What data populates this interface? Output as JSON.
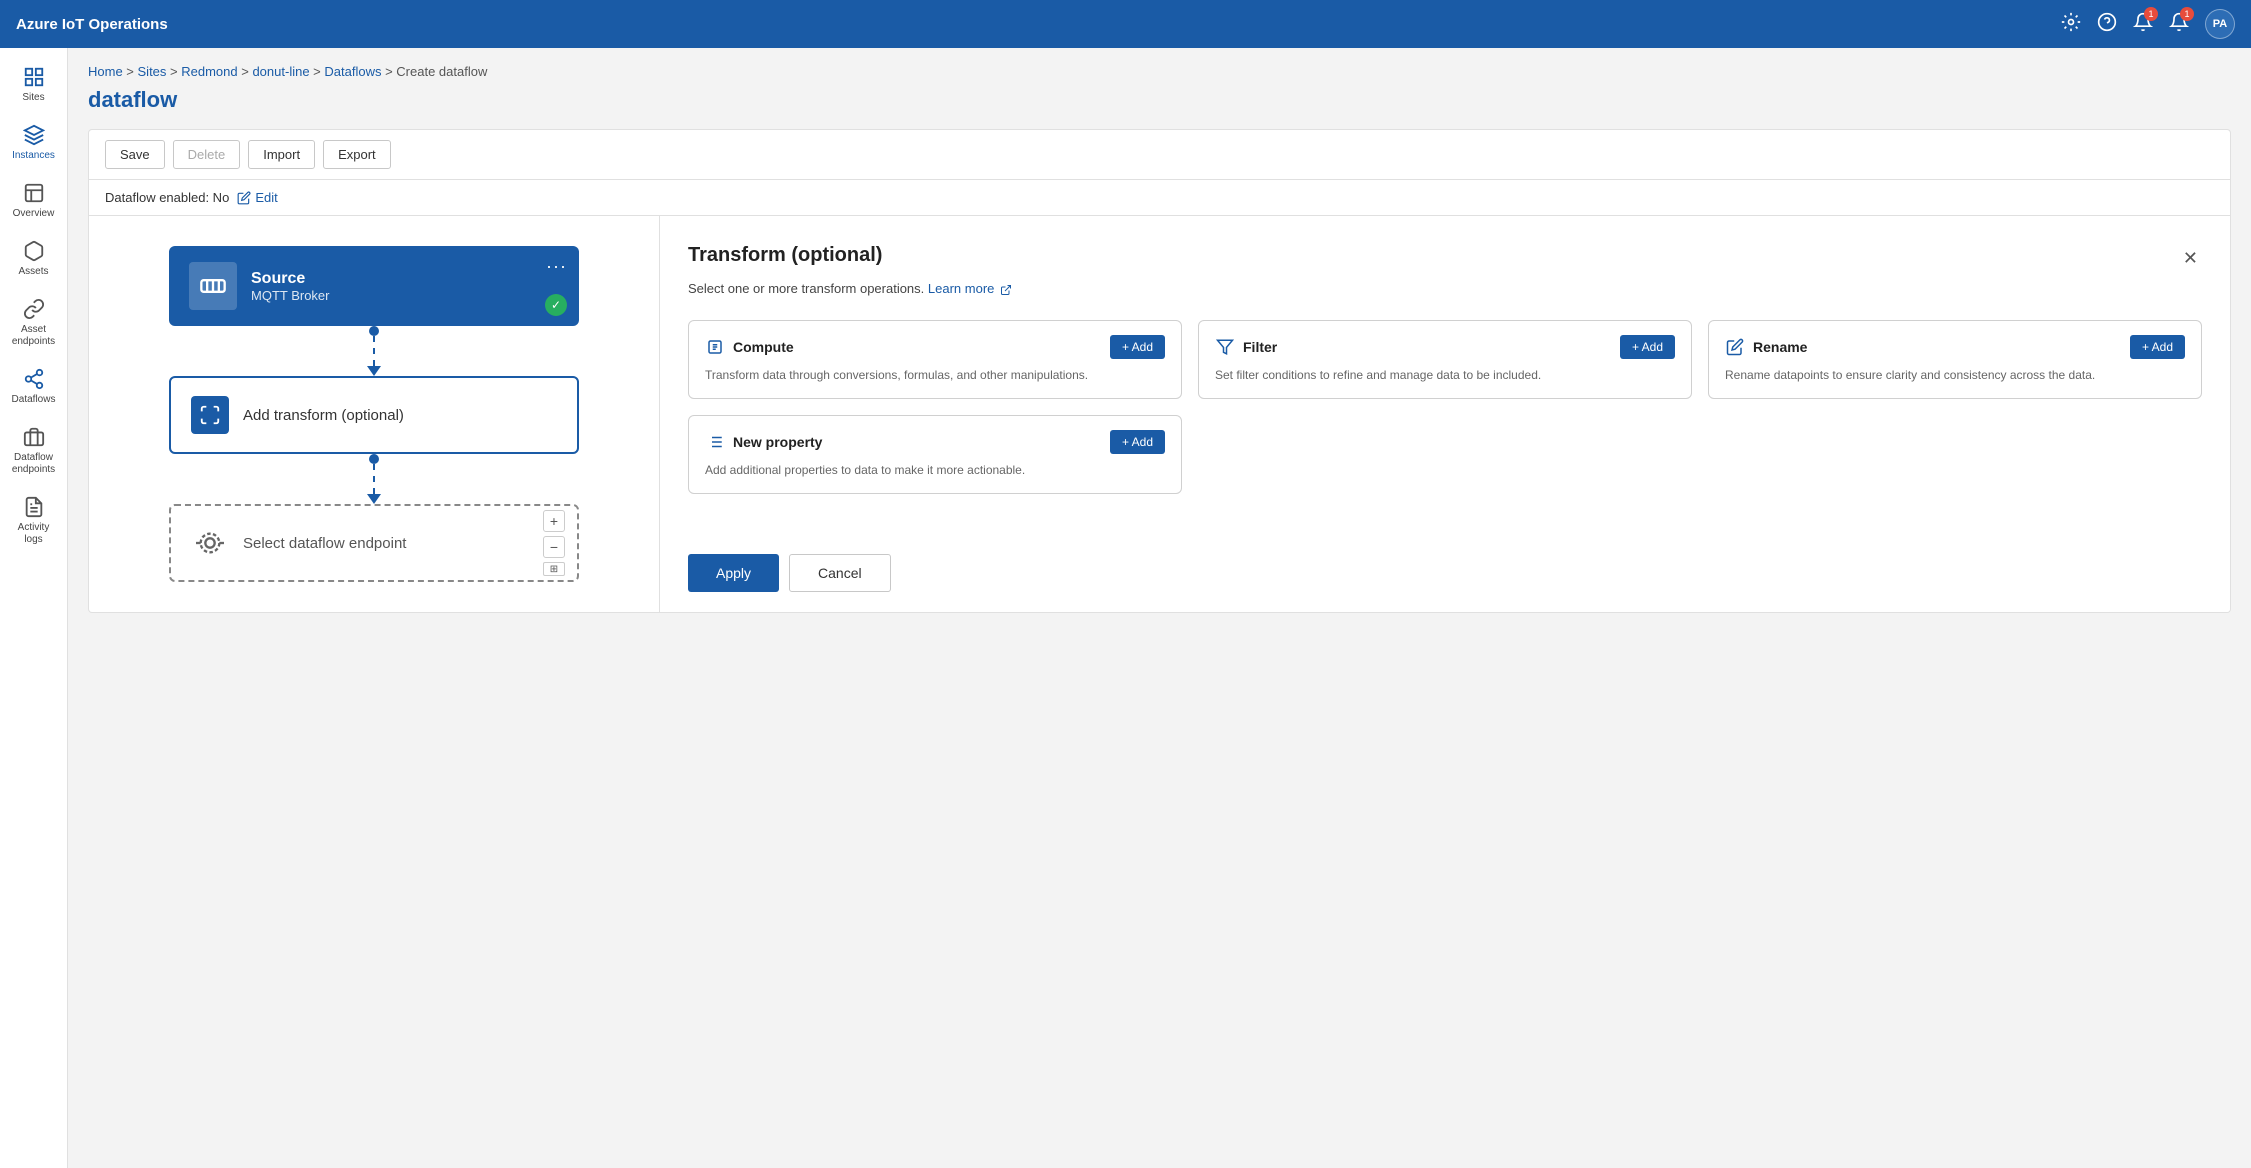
{
  "app": {
    "title": "Azure IoT Operations"
  },
  "topbar": {
    "title": "Azure IoT Operations",
    "avatar": "PA"
  },
  "sidebar": {
    "items": [
      {
        "id": "sites",
        "label": "Sites",
        "icon": "grid"
      },
      {
        "id": "instances",
        "label": "Instances",
        "icon": "layers",
        "active": true
      },
      {
        "id": "overview",
        "label": "Overview",
        "icon": "chart"
      },
      {
        "id": "assets",
        "label": "Assets",
        "icon": "box"
      },
      {
        "id": "asset-endpoints",
        "label": "Asset endpoints",
        "icon": "link"
      },
      {
        "id": "dataflows",
        "label": "Dataflows",
        "icon": "flow"
      },
      {
        "id": "dataflow-endpoints",
        "label": "Dataflow endpoints",
        "icon": "endpoint"
      },
      {
        "id": "activity-logs",
        "label": "Activity logs",
        "icon": "logs"
      }
    ]
  },
  "breadcrumb": {
    "items": [
      "Home",
      "Sites",
      "Redmond",
      "donut-line",
      "Dataflows",
      "Create dataflow"
    ],
    "separators": [
      ">",
      ">",
      ">",
      ">",
      ">"
    ]
  },
  "page": {
    "title": "dataflow"
  },
  "toolbar": {
    "save_label": "Save",
    "delete_label": "Delete",
    "import_label": "Import",
    "export_label": "Export"
  },
  "dataflow_status": {
    "label": "Dataflow enabled: No",
    "edit_label": "Edit"
  },
  "flow": {
    "source_node": {
      "title": "Source",
      "subtitle": "MQTT Broker",
      "menu": "..."
    },
    "transform_node": {
      "label": "Add transform (optional)"
    },
    "endpoint_node": {
      "label": "Select dataflow endpoint"
    }
  },
  "panel": {
    "title": "Transform (optional)",
    "subtitle": "Select one or more transform operations.",
    "learn_more": "Learn more",
    "close_label": "×",
    "cards": [
      {
        "id": "compute",
        "title": "Compute",
        "description": "Transform data through conversions, formulas, and other manipulations.",
        "add_label": "+ Add",
        "icon": "compute"
      },
      {
        "id": "filter",
        "title": "Filter",
        "description": "Set filter conditions to refine and manage data to be included.",
        "add_label": "+ Add",
        "icon": "filter"
      },
      {
        "id": "rename",
        "title": "Rename",
        "description": "Rename datapoints to ensure clarity and consistency across the data.",
        "add_label": "+ Add",
        "icon": "rename"
      },
      {
        "id": "new-property",
        "title": "New property",
        "description": "Add additional properties to data to make it more actionable.",
        "add_label": "+ Add",
        "icon": "property"
      }
    ],
    "apply_label": "Apply",
    "cancel_label": "Cancel"
  }
}
